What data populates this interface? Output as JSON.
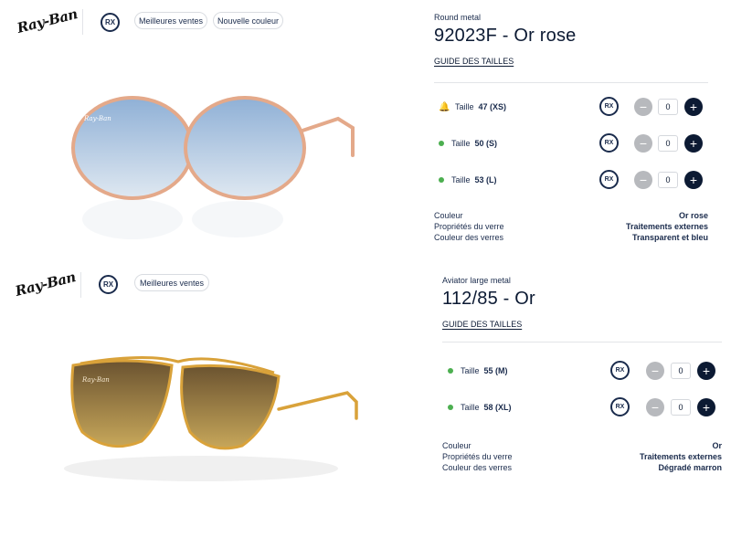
{
  "products": [
    {
      "brand": "Ray-Ban",
      "rx_badge": "RX",
      "tags": [
        "Meilleures ventes",
        "Nouvelle couleur"
      ],
      "model": "Round metal",
      "title": "92023F - Or rose",
      "size_guide": "GUIDE DES TAILLES",
      "size_label": "Taille",
      "sizes": [
        {
          "value": "47 (XS)",
          "status": "notify",
          "icon": "bell-icon",
          "rx": "RX",
          "qty": "0"
        },
        {
          "value": "50 (S)",
          "status": "available",
          "icon": "green-dot",
          "rx": "RX",
          "qty": "0"
        },
        {
          "value": "53 (L)",
          "status": "available",
          "icon": "green-dot",
          "rx": "RX",
          "qty": "0"
        }
      ],
      "properties": [
        {
          "label": "Couleur",
          "value": "Or rose"
        },
        {
          "label": "Propriétés du verre",
          "value": "Traitements externes"
        },
        {
          "label": "Couleur des verres",
          "value": "Transparent et bleu"
        }
      ],
      "frame_color": "#e4a98a",
      "lens_color": "#a9c4e0"
    },
    {
      "brand": "Ray-Ban",
      "rx_badge": "RX",
      "tags": [
        "Meilleures ventes"
      ],
      "model": "Aviator large metal",
      "title": "112/85 - Or",
      "size_guide": "GUIDE DES TAILLES",
      "size_label": "Taille",
      "sizes": [
        {
          "value": "55 (M)",
          "status": "available",
          "icon": "green-dot",
          "rx": "RX",
          "qty": "0"
        },
        {
          "value": "58 (XL)",
          "status": "available",
          "icon": "green-dot",
          "rx": "RX",
          "qty": "0"
        }
      ],
      "properties": [
        {
          "label": "Couleur",
          "value": "Or"
        },
        {
          "label": "Propriétés du verre",
          "value": "Traitements externes"
        },
        {
          "label": "Couleur des verres",
          "value": "Dégradé marron"
        }
      ],
      "frame_color": "#d9a23a",
      "lens_color": "#8a6a2e"
    }
  ],
  "colors": {
    "navy": "#0c1a33",
    "available": "#4caf50",
    "notify": "#d8a800",
    "minus_bg": "#b7b9bd"
  }
}
